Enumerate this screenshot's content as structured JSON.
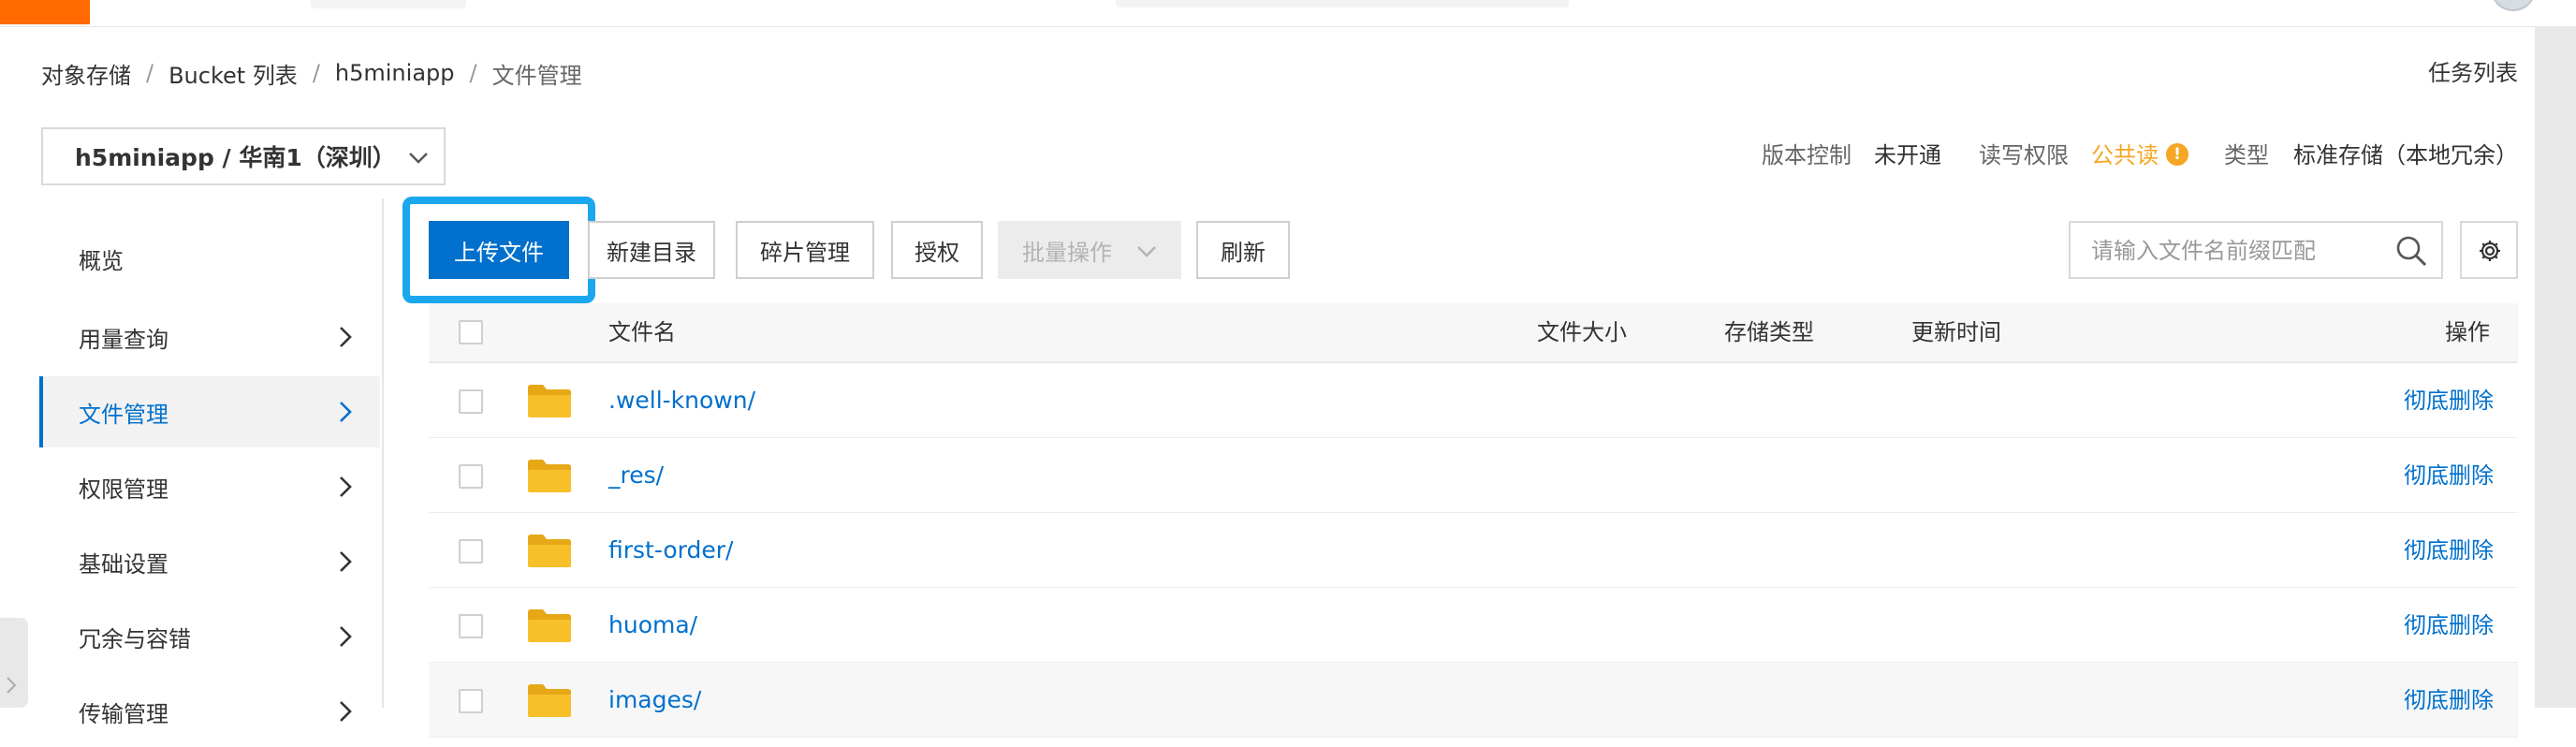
{
  "breadcrumb": [
    "对象存储",
    "Bucket 列表",
    "h5miniapp",
    "文件管理"
  ],
  "breadcrumb_separator": "/",
  "task_list_link": "任务列表",
  "bucket_selector": {
    "value": "h5miniapp / 华南1（深圳）"
  },
  "bucket_meta": {
    "version_control_label": "版本控制",
    "version_control_value": "未开通",
    "rw_permission_label": "读写权限",
    "rw_permission_value": "公共读",
    "rw_warning_symbol": "!",
    "storage_type_label": "类型",
    "storage_type_value": "标准存储（本地冗余）"
  },
  "sidebar": {
    "items": [
      {
        "label": "概览",
        "has_chevron": false,
        "active": false
      },
      {
        "label": "用量查询",
        "has_chevron": true,
        "active": false
      },
      {
        "label": "文件管理",
        "has_chevron": true,
        "active": true
      },
      {
        "label": "权限管理",
        "has_chevron": true,
        "active": false
      },
      {
        "label": "基础设置",
        "has_chevron": true,
        "active": false
      },
      {
        "label": "冗余与容错",
        "has_chevron": true,
        "active": false
      },
      {
        "label": "传输管理",
        "has_chevron": true,
        "active": false
      }
    ]
  },
  "toolbar": {
    "upload": "上传文件",
    "new_dir": "新建目录",
    "fragments": "碎片管理",
    "authorize": "授权",
    "batch": "批量操作",
    "refresh": "刷新",
    "search_placeholder": "请输入文件名前缀匹配"
  },
  "table": {
    "columns": [
      "文件名",
      "文件大小",
      "存储类型",
      "更新时间",
      "操作"
    ],
    "rows": [
      {
        "name": ".well-known/",
        "action": "彻底删除"
      },
      {
        "name": "_res/",
        "action": "彻底删除"
      },
      {
        "name": "first-order/",
        "action": "彻底删除"
      },
      {
        "name": "huoma/",
        "action": "彻底删除"
      },
      {
        "name": "images/",
        "action": "彻底删除"
      }
    ]
  },
  "icons": {
    "folder": "folder-icon",
    "search": "search-icon",
    "settings": "gear-icon",
    "chevron": "chevron-right-icon",
    "dropdown": "chevron-down-icon"
  },
  "colors": {
    "primary": "#0070cc",
    "highlight_border": "#1aa7ee",
    "brand_orange": "#ff6a00",
    "warning": "#f5a623",
    "folder": "#f7c02b"
  }
}
